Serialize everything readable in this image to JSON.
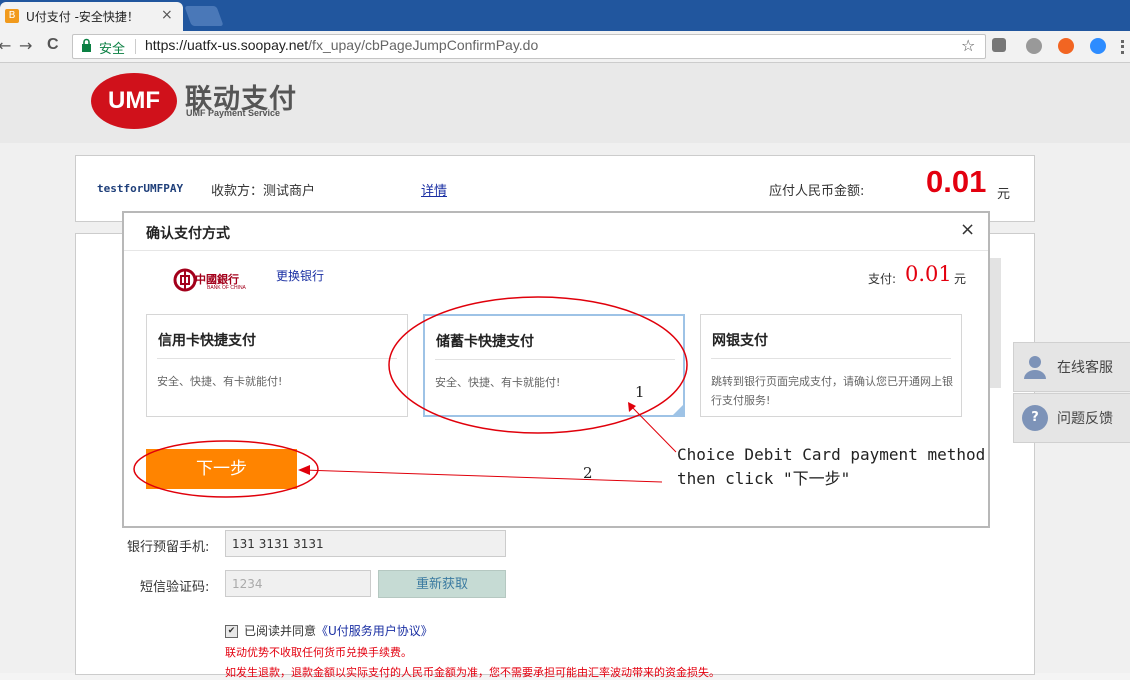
{
  "browser": {
    "tab_title": "U付支付 -安全快捷！",
    "tab_close": "×",
    "tab_icon_glyph": "B",
    "secure_label": "安全",
    "url_host": "https://uatfx-us.soopay.net",
    "url_path": "/fx_upay/cbPageJumpConfirmPay.do",
    "nav_back": "←",
    "nav_forward": "→",
    "nav_reload": "C",
    "star": "☆"
  },
  "brand": {
    "logo_text": "UMF",
    "name_cn": "联动支付",
    "name_en": "UMF Payment Service"
  },
  "merchant": {
    "name": "testforUMFPAY",
    "payee": "收款方：测试商户",
    "detail_link": "详情",
    "amount_label": "应付人民币金额:",
    "amount": "0.01",
    "currency": "元"
  },
  "modal": {
    "title": "确认支付方式",
    "close": "×",
    "bank_cn": "中國銀行",
    "bank_en": "BANK OF CHINA",
    "change_bank": "更换银行",
    "pay_label": "支付:",
    "pay_amount": "0.01",
    "pay_currency": "元",
    "options": [
      {
        "title": "信用卡快捷支付",
        "desc": "安全、快捷、有卡就能付!"
      },
      {
        "title": "储蓄卡快捷支付",
        "desc": "安全、快捷、有卡就能付!"
      },
      {
        "title": "网银支付",
        "desc": "跳转到银行页面完成支付，请确认您已开通网上银行支付服务!"
      }
    ],
    "next_button": "下一步"
  },
  "form": {
    "phone_label": "银行预留手机:",
    "phone_value": "131 3131 3131",
    "sms_label": "短信验证码:",
    "sms_placeholder": "1234",
    "resend_button": "重新获取",
    "agree_prefix": "已阅读并同意",
    "agree_link": "《U付服务用户协议》",
    "checkbox_mark": "✔",
    "note_1": "联动优势不收取任何货币兑换手续费。",
    "note_2": "如发生退款，退款金额以实际支付的人民币金额为准，您不需要承担可能由汇率波动带来的资金损失。"
  },
  "side": {
    "service": "在线客服",
    "feedback": "问题反馈",
    "feedback_glyph": "?"
  },
  "annotation": {
    "label_1": "1",
    "label_2": "2",
    "line_1": "Choice Debit Card payment method",
    "line_2": "then click \"下一步\""
  },
  "colors": {
    "brand_red": "#d0111b",
    "amount_red": "#e3000f",
    "next_orange": "#ff8400",
    "annotation_red": "#e0000b",
    "link_blue": "#1a2fa3"
  }
}
